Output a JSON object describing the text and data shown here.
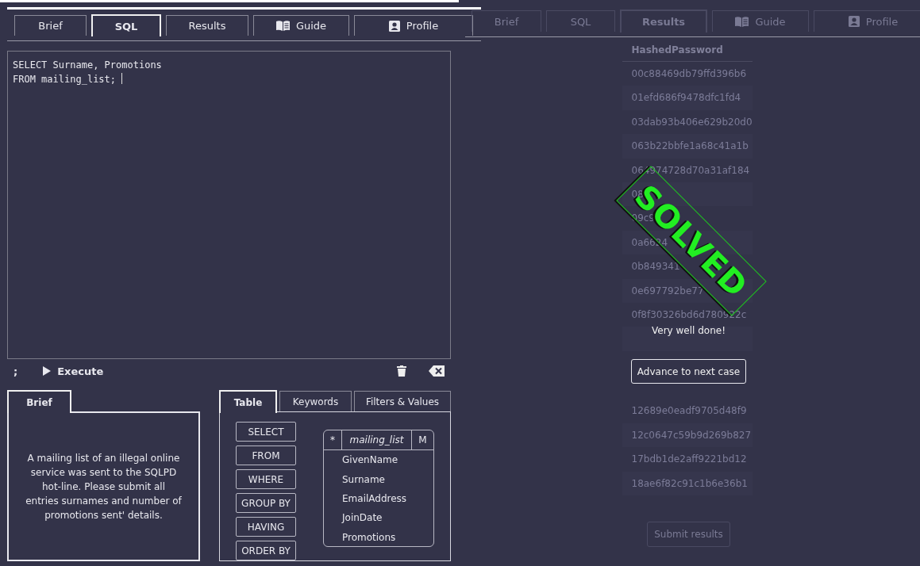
{
  "left": {
    "tabs": [
      {
        "label": "Brief",
        "selected": false
      },
      {
        "label": "SQL",
        "selected": true
      },
      {
        "label": "Results",
        "selected": false
      },
      {
        "label": "Guide",
        "selected": false
      },
      {
        "label": "Profile",
        "selected": false
      }
    ],
    "editor": {
      "lines": [
        "SELECT Surname, Promotions",
        "FROM mailing_list; "
      ]
    },
    "toolbar": {
      "semicolon": ";",
      "execute": "Execute"
    },
    "brief": {
      "tab": "Brief",
      "text": "A mailing list of an illegal online service was sent to the SQLPD hot-line. Please submit all entries surnames and number of promotions sent' details."
    },
    "helper": {
      "tabs": [
        {
          "label": "Table",
          "selected": true
        },
        {
          "label": "Keywords",
          "selected": false
        },
        {
          "label": "Filters & Values",
          "selected": false
        }
      ],
      "keywords": [
        "SELECT",
        "FROM",
        "WHERE",
        "GROUP BY",
        "HAVING",
        "ORDER BY"
      ],
      "table": {
        "star": "*",
        "name": "mailing_list",
        "mark": "M",
        "columns": [
          "GivenName",
          "Surname",
          "EmailAddress",
          "JoinDate",
          "Promotions"
        ]
      }
    }
  },
  "right": {
    "tabs": [
      {
        "label": "Brief",
        "selected": false
      },
      {
        "label": "SQL",
        "selected": false
      },
      {
        "label": "Results",
        "selected": true
      },
      {
        "label": "Guide",
        "selected": false
      },
      {
        "label": "Profile",
        "selected": false
      }
    ],
    "results": {
      "column": "HashedPassword",
      "rows_above": [
        "00c88469db79ffd396b6",
        "01efd686f9478dfc1fd4",
        "03dab93b406e629b20d0",
        "063b22bbfe1a68c41a1b",
        "064974728d70a31af184",
        "08",
        "09c9",
        "0a6624",
        "0b849341",
        "0e697792be77",
        "0f8f30326bd6d780922c"
      ],
      "rows_below": [
        "12689e0eadf9705d48f9",
        "12c0647c59b9d269b827",
        "17bdb1de2aff9221bd12",
        "18ae6f82c91c1b6e36b1"
      ]
    },
    "submit": "Submit results",
    "stamp": "SOLVED",
    "message": "Very well done!",
    "advance": "Advance to next case"
  }
}
